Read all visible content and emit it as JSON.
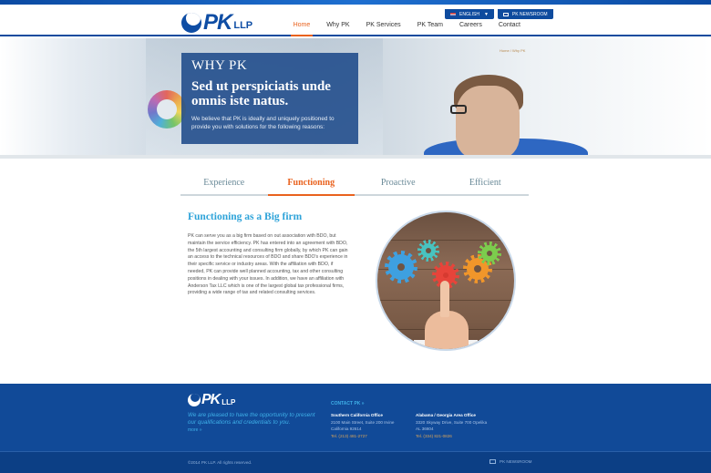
{
  "header": {
    "logo_text": "PK",
    "logo_suffix": "LLP",
    "language_label": "ENGLISH",
    "newsroom_label": "PK NEWSROOM",
    "nav": [
      {
        "label": "Home",
        "active": true
      },
      {
        "label": "Why PK",
        "active": false
      },
      {
        "label": "PK Services",
        "active": false
      },
      {
        "label": "PK Team",
        "active": false
      },
      {
        "label": "Careers",
        "active": false
      },
      {
        "label": "Contact",
        "active": false
      }
    ]
  },
  "hero": {
    "kicker": "WHY PK",
    "headline": "Sed ut perspiciatis unde omnis iste natus.",
    "subtext": "We believe that PK is ideally and uniquely positioned to provide you with solutions for the following reasons:",
    "breadcrumb": "Home / Why PK"
  },
  "tabs": [
    {
      "label": "Experience",
      "active": false
    },
    {
      "label": "Functioning",
      "active": true
    },
    {
      "label": "Proactive",
      "active": false
    },
    {
      "label": "Efficient",
      "active": false
    }
  ],
  "content": {
    "title": "Functioning as a Big firm",
    "body": "PK can serve you as a big firm based on out association with BDO, but maintain the service efficiency. PK has entered into an agreement with BDO, the 5th largest accounting and consulting firm globally, by which PK can gain an access to the technical resources of BDO and share BDO's experience in their specific service or industry areas. With the affiliation with BDO, if needed, PK can provide well planned accounting, tax and other consulting positions in dealing with your issues. In addition, we have an affiliation with Anderson Tax LLC which is one of the largest global tax professional firms, providing a wide range of tax and related consulting services."
  },
  "footer": {
    "logo_text": "PK",
    "logo_suffix": "LLP",
    "tagline": "We are pleased to have the opportunity to present our qualifications and credentials to you.",
    "more_label": "more »",
    "contact_heading": "CONTACT PK »",
    "offices": [
      {
        "name": "Southern California Office",
        "address1": "2100 Main Street, Suite 200 Irvine",
        "address2": "California 92614",
        "phone": "Tel. (213) 481-2727"
      },
      {
        "name": "Alabama / Georgia Area Office",
        "address1": "3320 Skyway Drive, Suite 700 Opelika",
        "address2": "AL 36804",
        "phone": "Tel. (334) 821-0826"
      }
    ],
    "copyright": "©2014 PK LLP. All rights reserved.",
    "newsroom_label": "PK NEWSROOM"
  },
  "colors": {
    "brand_blue": "#0e4da4",
    "accent_orange": "#e9621e",
    "title_cyan": "#2ea3d9",
    "footer_blue": "#114a98"
  }
}
